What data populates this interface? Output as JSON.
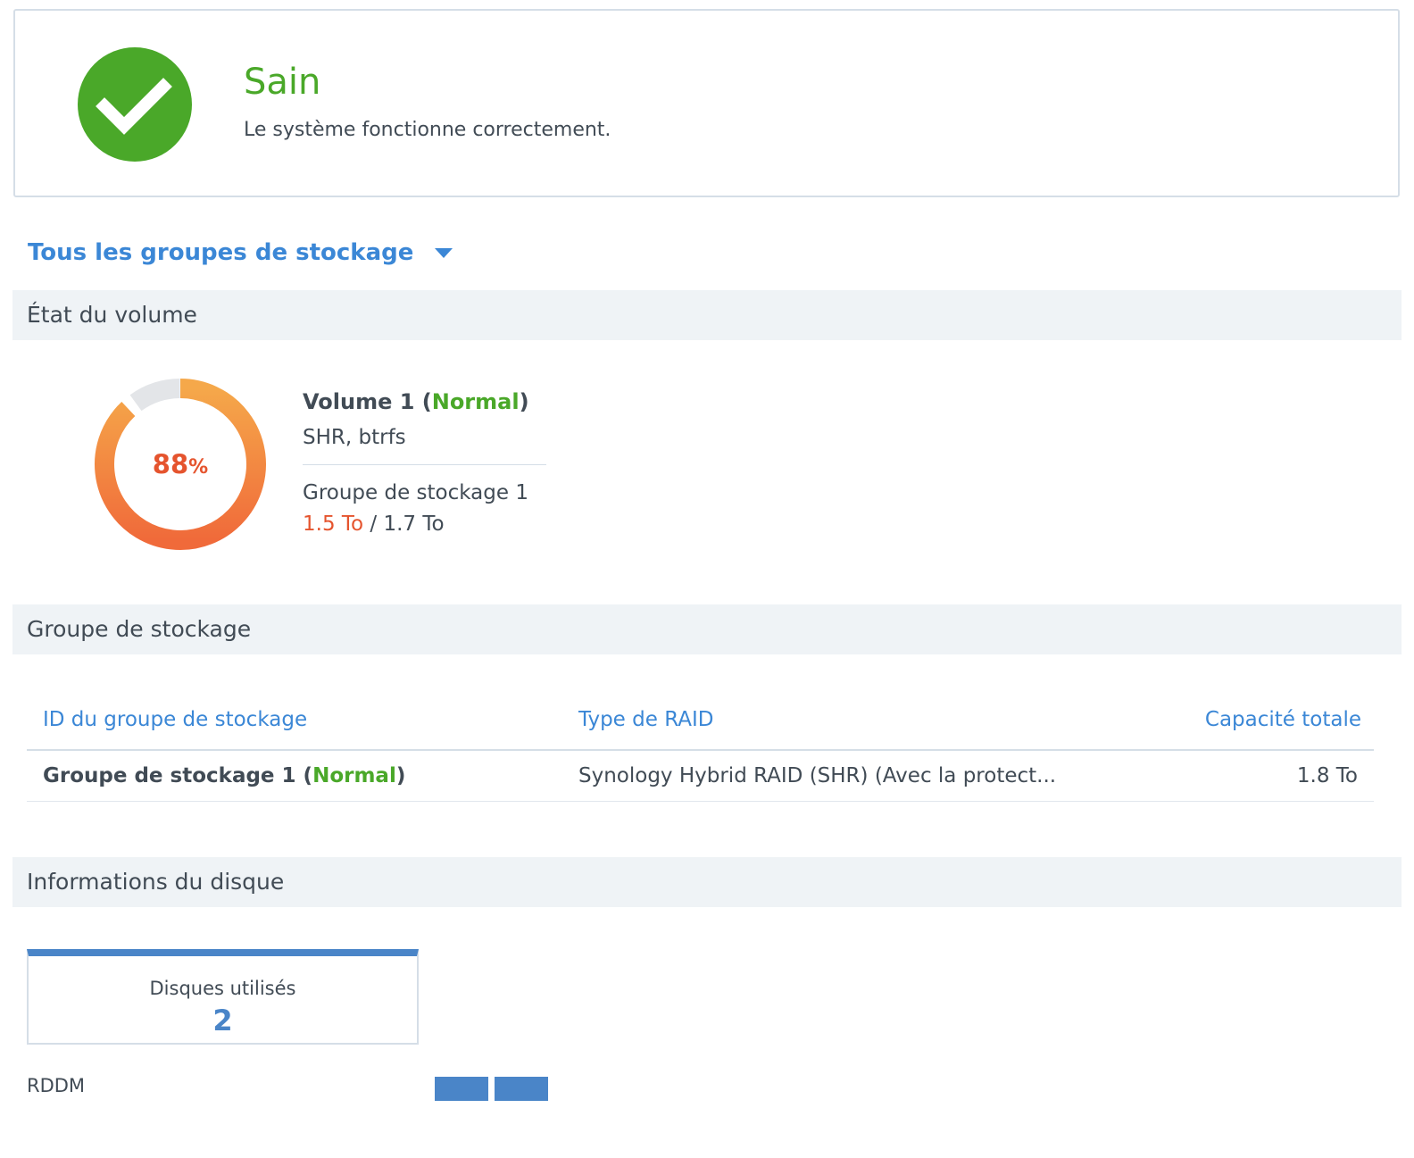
{
  "status": {
    "title": "Sain",
    "description": "Le système fonctionne correctement.",
    "icon": "check-circle-icon",
    "color": "#4aa829"
  },
  "group_selector": {
    "label": "Tous les groupes de stockage",
    "icon": "caret-down-icon"
  },
  "volume_section": {
    "header": "État du volume",
    "usage_percent": 88,
    "usage_percent_label": "88",
    "percent_sign": "%",
    "volume_name": "Volume 1",
    "volume_status": "Normal",
    "volume_type": "SHR, btrfs",
    "pool_name": "Groupe de stockage 1",
    "used": "1.5 To",
    "separator": "/",
    "total": "1.7 To",
    "colors": {
      "used_start": "#f5a84a",
      "used_end": "#f06a3a",
      "free": "#e3e5e8"
    }
  },
  "pool_section": {
    "header": "Groupe de stockage",
    "columns": [
      "ID du groupe de stockage",
      "Type de RAID",
      "Capacité totale"
    ],
    "rows": [
      {
        "name": "Groupe de stockage 1",
        "status": "Normal",
        "raid_type": "Synology Hybrid RAID (SHR) (Avec la protect...",
        "capacity": "1.8 To"
      }
    ]
  },
  "disk_section": {
    "header": "Informations du disque",
    "used_disks_label": "Disques utilisés",
    "used_disks_count": "2",
    "model": "RDDM",
    "slots_in_use": 2
  }
}
